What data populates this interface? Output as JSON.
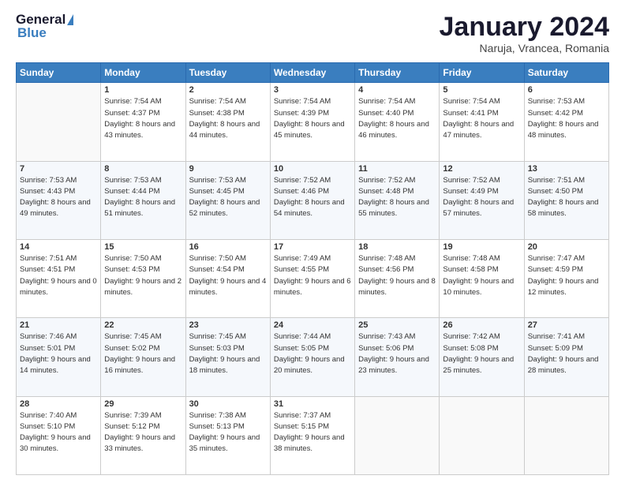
{
  "header": {
    "logo_general": "General",
    "logo_blue": "Blue",
    "main_title": "January 2024",
    "subtitle": "Naruja, Vrancea, Romania"
  },
  "weekdays": [
    "Sunday",
    "Monday",
    "Tuesday",
    "Wednesday",
    "Thursday",
    "Friday",
    "Saturday"
  ],
  "weeks": [
    [
      {
        "day": "",
        "sunrise": "",
        "sunset": "",
        "daylight": ""
      },
      {
        "day": "1",
        "sunrise": "Sunrise: 7:54 AM",
        "sunset": "Sunset: 4:37 PM",
        "daylight": "Daylight: 8 hours and 43 minutes."
      },
      {
        "day": "2",
        "sunrise": "Sunrise: 7:54 AM",
        "sunset": "Sunset: 4:38 PM",
        "daylight": "Daylight: 8 hours and 44 minutes."
      },
      {
        "day": "3",
        "sunrise": "Sunrise: 7:54 AM",
        "sunset": "Sunset: 4:39 PM",
        "daylight": "Daylight: 8 hours and 45 minutes."
      },
      {
        "day": "4",
        "sunrise": "Sunrise: 7:54 AM",
        "sunset": "Sunset: 4:40 PM",
        "daylight": "Daylight: 8 hours and 46 minutes."
      },
      {
        "day": "5",
        "sunrise": "Sunrise: 7:54 AM",
        "sunset": "Sunset: 4:41 PM",
        "daylight": "Daylight: 8 hours and 47 minutes."
      },
      {
        "day": "6",
        "sunrise": "Sunrise: 7:53 AM",
        "sunset": "Sunset: 4:42 PM",
        "daylight": "Daylight: 8 hours and 48 minutes."
      }
    ],
    [
      {
        "day": "7",
        "sunrise": "Sunrise: 7:53 AM",
        "sunset": "Sunset: 4:43 PM",
        "daylight": "Daylight: 8 hours and 49 minutes."
      },
      {
        "day": "8",
        "sunrise": "Sunrise: 7:53 AM",
        "sunset": "Sunset: 4:44 PM",
        "daylight": "Daylight: 8 hours and 51 minutes."
      },
      {
        "day": "9",
        "sunrise": "Sunrise: 7:53 AM",
        "sunset": "Sunset: 4:45 PM",
        "daylight": "Daylight: 8 hours and 52 minutes."
      },
      {
        "day": "10",
        "sunrise": "Sunrise: 7:52 AM",
        "sunset": "Sunset: 4:46 PM",
        "daylight": "Daylight: 8 hours and 54 minutes."
      },
      {
        "day": "11",
        "sunrise": "Sunrise: 7:52 AM",
        "sunset": "Sunset: 4:48 PM",
        "daylight": "Daylight: 8 hours and 55 minutes."
      },
      {
        "day": "12",
        "sunrise": "Sunrise: 7:52 AM",
        "sunset": "Sunset: 4:49 PM",
        "daylight": "Daylight: 8 hours and 57 minutes."
      },
      {
        "day": "13",
        "sunrise": "Sunrise: 7:51 AM",
        "sunset": "Sunset: 4:50 PM",
        "daylight": "Daylight: 8 hours and 58 minutes."
      }
    ],
    [
      {
        "day": "14",
        "sunrise": "Sunrise: 7:51 AM",
        "sunset": "Sunset: 4:51 PM",
        "daylight": "Daylight: 9 hours and 0 minutes."
      },
      {
        "day": "15",
        "sunrise": "Sunrise: 7:50 AM",
        "sunset": "Sunset: 4:53 PM",
        "daylight": "Daylight: 9 hours and 2 minutes."
      },
      {
        "day": "16",
        "sunrise": "Sunrise: 7:50 AM",
        "sunset": "Sunset: 4:54 PM",
        "daylight": "Daylight: 9 hours and 4 minutes."
      },
      {
        "day": "17",
        "sunrise": "Sunrise: 7:49 AM",
        "sunset": "Sunset: 4:55 PM",
        "daylight": "Daylight: 9 hours and 6 minutes."
      },
      {
        "day": "18",
        "sunrise": "Sunrise: 7:48 AM",
        "sunset": "Sunset: 4:56 PM",
        "daylight": "Daylight: 9 hours and 8 minutes."
      },
      {
        "day": "19",
        "sunrise": "Sunrise: 7:48 AM",
        "sunset": "Sunset: 4:58 PM",
        "daylight": "Daylight: 9 hours and 10 minutes."
      },
      {
        "day": "20",
        "sunrise": "Sunrise: 7:47 AM",
        "sunset": "Sunset: 4:59 PM",
        "daylight": "Daylight: 9 hours and 12 minutes."
      }
    ],
    [
      {
        "day": "21",
        "sunrise": "Sunrise: 7:46 AM",
        "sunset": "Sunset: 5:01 PM",
        "daylight": "Daylight: 9 hours and 14 minutes."
      },
      {
        "day": "22",
        "sunrise": "Sunrise: 7:45 AM",
        "sunset": "Sunset: 5:02 PM",
        "daylight": "Daylight: 9 hours and 16 minutes."
      },
      {
        "day": "23",
        "sunrise": "Sunrise: 7:45 AM",
        "sunset": "Sunset: 5:03 PM",
        "daylight": "Daylight: 9 hours and 18 minutes."
      },
      {
        "day": "24",
        "sunrise": "Sunrise: 7:44 AM",
        "sunset": "Sunset: 5:05 PM",
        "daylight": "Daylight: 9 hours and 20 minutes."
      },
      {
        "day": "25",
        "sunrise": "Sunrise: 7:43 AM",
        "sunset": "Sunset: 5:06 PM",
        "daylight": "Daylight: 9 hours and 23 minutes."
      },
      {
        "day": "26",
        "sunrise": "Sunrise: 7:42 AM",
        "sunset": "Sunset: 5:08 PM",
        "daylight": "Daylight: 9 hours and 25 minutes."
      },
      {
        "day": "27",
        "sunrise": "Sunrise: 7:41 AM",
        "sunset": "Sunset: 5:09 PM",
        "daylight": "Daylight: 9 hours and 28 minutes."
      }
    ],
    [
      {
        "day": "28",
        "sunrise": "Sunrise: 7:40 AM",
        "sunset": "Sunset: 5:10 PM",
        "daylight": "Daylight: 9 hours and 30 minutes."
      },
      {
        "day": "29",
        "sunrise": "Sunrise: 7:39 AM",
        "sunset": "Sunset: 5:12 PM",
        "daylight": "Daylight: 9 hours and 33 minutes."
      },
      {
        "day": "30",
        "sunrise": "Sunrise: 7:38 AM",
        "sunset": "Sunset: 5:13 PM",
        "daylight": "Daylight: 9 hours and 35 minutes."
      },
      {
        "day": "31",
        "sunrise": "Sunrise: 7:37 AM",
        "sunset": "Sunset: 5:15 PM",
        "daylight": "Daylight: 9 hours and 38 minutes."
      },
      {
        "day": "",
        "sunrise": "",
        "sunset": "",
        "daylight": ""
      },
      {
        "day": "",
        "sunrise": "",
        "sunset": "",
        "daylight": ""
      },
      {
        "day": "",
        "sunrise": "",
        "sunset": "",
        "daylight": ""
      }
    ]
  ]
}
